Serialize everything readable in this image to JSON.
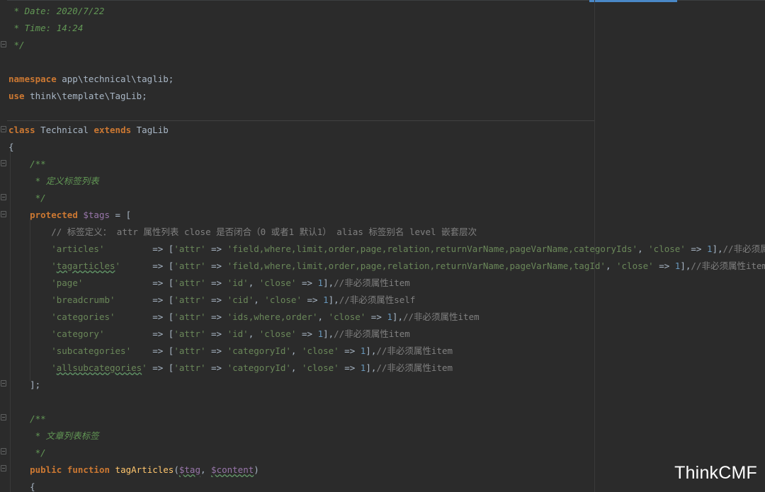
{
  "lines": [
    [
      [
        "doc",
        " * Date: 2020/7/22"
      ]
    ],
    [
      [
        "doc",
        " * Time: 14:24"
      ]
    ],
    [
      [
        "doc",
        " */"
      ]
    ],
    [],
    [
      [
        "kw",
        "namespace"
      ],
      [
        "plain",
        " app\\technical\\taglib;"
      ]
    ],
    [
      [
        "kw",
        "use"
      ],
      [
        "plain",
        " think\\template\\TagLib;"
      ]
    ],
    [],
    [
      [
        "kw",
        "class"
      ],
      [
        "plain",
        " Technical "
      ],
      [
        "kw",
        "extends"
      ],
      [
        "plain",
        " TagLib"
      ]
    ],
    [
      [
        "plain",
        "{"
      ]
    ],
    [
      [
        "doc",
        "    /**"
      ]
    ],
    [
      [
        "doc",
        "     * 定义标签列表"
      ]
    ],
    [
      [
        "doc",
        "     */"
      ]
    ],
    [
      [
        "plain",
        "    "
      ],
      [
        "kw",
        "protected"
      ],
      [
        "plain",
        " "
      ],
      [
        "var",
        "$tags"
      ],
      [
        "plain",
        " = ["
      ]
    ],
    [
      [
        "cmt",
        "        // 标签定义： attr 属性列表 close 是否闭合（0 或者1 默认1） alias 标签别名 level 嵌套层次"
      ]
    ],
    [
      [
        "plain",
        "        "
      ],
      [
        "str",
        "'articles'"
      ],
      [
        "plain",
        "         => ["
      ],
      [
        "str",
        "'attr'"
      ],
      [
        "plain",
        " => "
      ],
      [
        "str",
        "'field,where,limit,order,page,relation,returnVarName,pageVarName,categoryIds'"
      ],
      [
        "plain",
        ", "
      ],
      [
        "str",
        "'close'"
      ],
      [
        "plain",
        " => "
      ],
      [
        "num",
        "1"
      ],
      [
        "plain",
        "],"
      ],
      [
        "cmt",
        "//非必须属性item"
      ]
    ],
    [
      [
        "plain",
        "        "
      ],
      [
        "str",
        "'"
      ],
      [
        "strtypo",
        "tagarticles"
      ],
      [
        "str",
        "'"
      ],
      [
        "plain",
        "      => ["
      ],
      [
        "str",
        "'attr'"
      ],
      [
        "plain",
        " => "
      ],
      [
        "str",
        "'field,where,limit,order,page,relation,returnVarName,pageVarName,tagId'"
      ],
      [
        "plain",
        ", "
      ],
      [
        "str",
        "'close'"
      ],
      [
        "plain",
        " => "
      ],
      [
        "num",
        "1"
      ],
      [
        "plain",
        "],"
      ],
      [
        "cmt",
        "//非必须属性item"
      ]
    ],
    [
      [
        "plain",
        "        "
      ],
      [
        "str",
        "'page'"
      ],
      [
        "plain",
        "             => ["
      ],
      [
        "str",
        "'attr'"
      ],
      [
        "plain",
        " => "
      ],
      [
        "str",
        "'id'"
      ],
      [
        "plain",
        ", "
      ],
      [
        "str",
        "'close'"
      ],
      [
        "plain",
        " => "
      ],
      [
        "num",
        "1"
      ],
      [
        "plain",
        "],"
      ],
      [
        "cmt",
        "//非必须属性item"
      ]
    ],
    [
      [
        "plain",
        "        "
      ],
      [
        "str",
        "'breadcrumb'"
      ],
      [
        "plain",
        "       => ["
      ],
      [
        "str",
        "'attr'"
      ],
      [
        "plain",
        " => "
      ],
      [
        "str",
        "'cid'"
      ],
      [
        "plain",
        ", "
      ],
      [
        "str",
        "'close'"
      ],
      [
        "plain",
        " => "
      ],
      [
        "num",
        "1"
      ],
      [
        "plain",
        "],"
      ],
      [
        "cmt",
        "//非必须属性self"
      ]
    ],
    [
      [
        "plain",
        "        "
      ],
      [
        "str",
        "'categories'"
      ],
      [
        "plain",
        "       => ["
      ],
      [
        "str",
        "'attr'"
      ],
      [
        "plain",
        " => "
      ],
      [
        "str",
        "'ids,where,order'"
      ],
      [
        "plain",
        ", "
      ],
      [
        "str",
        "'close'"
      ],
      [
        "plain",
        " => "
      ],
      [
        "num",
        "1"
      ],
      [
        "plain",
        "],"
      ],
      [
        "cmt",
        "//非必须属性item"
      ]
    ],
    [
      [
        "plain",
        "        "
      ],
      [
        "str",
        "'category'"
      ],
      [
        "plain",
        "         => ["
      ],
      [
        "str",
        "'attr'"
      ],
      [
        "plain",
        " => "
      ],
      [
        "str",
        "'id'"
      ],
      [
        "plain",
        ", "
      ],
      [
        "str",
        "'close'"
      ],
      [
        "plain",
        " => "
      ],
      [
        "num",
        "1"
      ],
      [
        "plain",
        "],"
      ],
      [
        "cmt",
        "//非必须属性item"
      ]
    ],
    [
      [
        "plain",
        "        "
      ],
      [
        "str",
        "'subcategories'"
      ],
      [
        "plain",
        "    => ["
      ],
      [
        "str",
        "'attr'"
      ],
      [
        "plain",
        " => "
      ],
      [
        "str",
        "'categoryId'"
      ],
      [
        "plain",
        ", "
      ],
      [
        "str",
        "'close'"
      ],
      [
        "plain",
        " => "
      ],
      [
        "num",
        "1"
      ],
      [
        "plain",
        "],"
      ],
      [
        "cmt",
        "//非必须属性item"
      ]
    ],
    [
      [
        "plain",
        "        "
      ],
      [
        "str",
        "'"
      ],
      [
        "strtypo",
        "allsubcategories"
      ],
      [
        "str",
        "'"
      ],
      [
        "plain",
        " => ["
      ],
      [
        "str",
        "'attr'"
      ],
      [
        "plain",
        " => "
      ],
      [
        "str",
        "'categoryId'"
      ],
      [
        "plain",
        ", "
      ],
      [
        "str",
        "'close'"
      ],
      [
        "plain",
        " => "
      ],
      [
        "num",
        "1"
      ],
      [
        "plain",
        "],"
      ],
      [
        "cmt",
        "//非必须属性item"
      ]
    ],
    [
      [
        "plain",
        "    ];"
      ]
    ],
    [],
    [
      [
        "doc",
        "    /**"
      ]
    ],
    [
      [
        "doc",
        "     * 文章列表标签"
      ]
    ],
    [
      [
        "doc",
        "     */"
      ]
    ],
    [
      [
        "plain",
        "    "
      ],
      [
        "kw",
        "public"
      ],
      [
        "plain",
        " "
      ],
      [
        "kw",
        "function"
      ],
      [
        "plain",
        " "
      ],
      [
        "fn",
        "tagArticles"
      ],
      [
        "plain",
        "("
      ],
      [
        "vartypo",
        "$tag"
      ],
      [
        "plain",
        ", "
      ],
      [
        "vartypo",
        "$content"
      ],
      [
        "plain",
        ")"
      ]
    ],
    [
      [
        "plain",
        "    {"
      ]
    ]
  ],
  "watermark": "ThinkCMF",
  "colors": {
    "background": "#2b2b2b",
    "keyword": "#cc7832",
    "string": "#6a8759",
    "number": "#6897bb",
    "variable": "#9876aa",
    "function": "#ffc66d",
    "doc_comment": "#629755",
    "line_comment": "#808080",
    "text": "#a9b7c6"
  }
}
